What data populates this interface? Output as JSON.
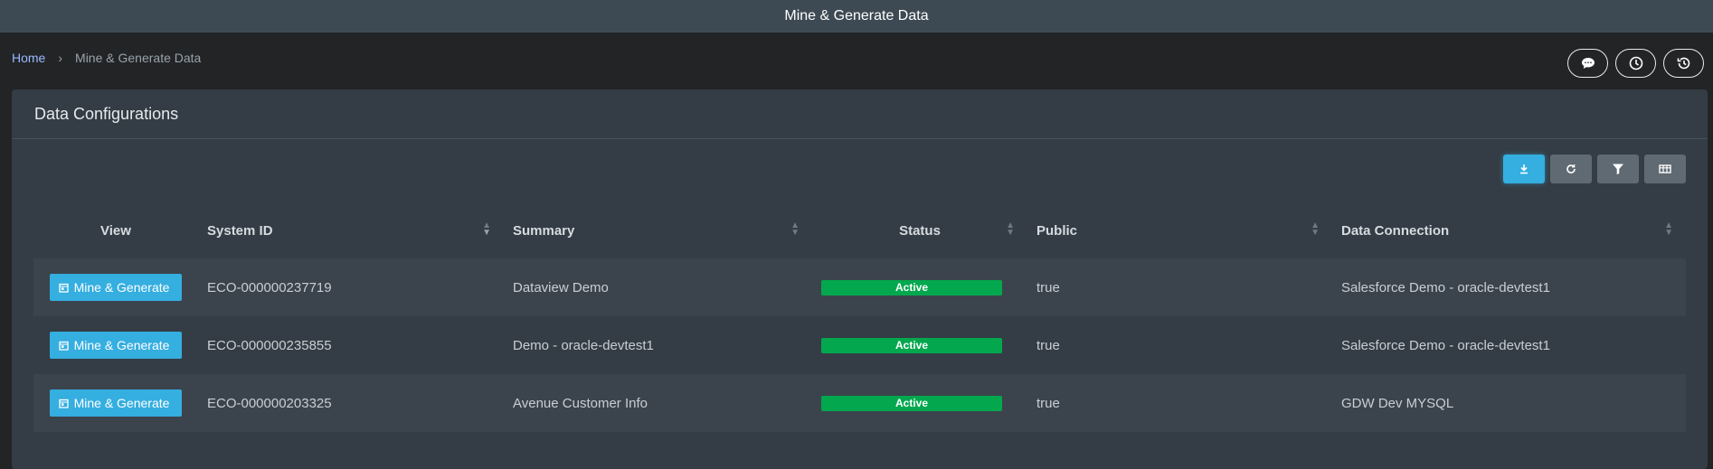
{
  "app": {
    "title": "Mine & Generate Data"
  },
  "breadcrumb": {
    "home": "Home",
    "current": "Mine & Generate Data"
  },
  "card": {
    "title": "Data Configurations"
  },
  "table": {
    "headers": {
      "view": "View",
      "system_id": "System ID",
      "summary": "Summary",
      "status": "Status",
      "public": "Public",
      "connection": "Data Connection"
    },
    "rows": [
      {
        "action": "Mine & Generate",
        "system_id": "ECO-000000237719",
        "summary": "Dataview Demo",
        "status": "Active",
        "public": "true",
        "connection": "Salesforce Demo - oracle-devtest1"
      },
      {
        "action": "Mine & Generate",
        "system_id": "ECO-000000235855",
        "summary": "Demo - oracle-devtest1",
        "status": "Active",
        "public": "true",
        "connection": "Salesforce Demo - oracle-devtest1"
      },
      {
        "action": "Mine & Generate",
        "system_id": "ECO-000000203325",
        "summary": "Avenue Customer Info",
        "status": "Active",
        "public": "true",
        "connection": "GDW Dev MYSQL"
      }
    ]
  },
  "icons": {
    "chat": "chat-icon",
    "clock": "clock-icon",
    "history": "history-icon",
    "download": "download-icon",
    "refresh": "refresh-icon",
    "filter": "filter-icon",
    "columns": "columns-icon",
    "calendar": "calendar-icon"
  },
  "colors": {
    "accent": "#35aee0",
    "status_active": "#03a84e",
    "topbar": "#3e4a53"
  }
}
